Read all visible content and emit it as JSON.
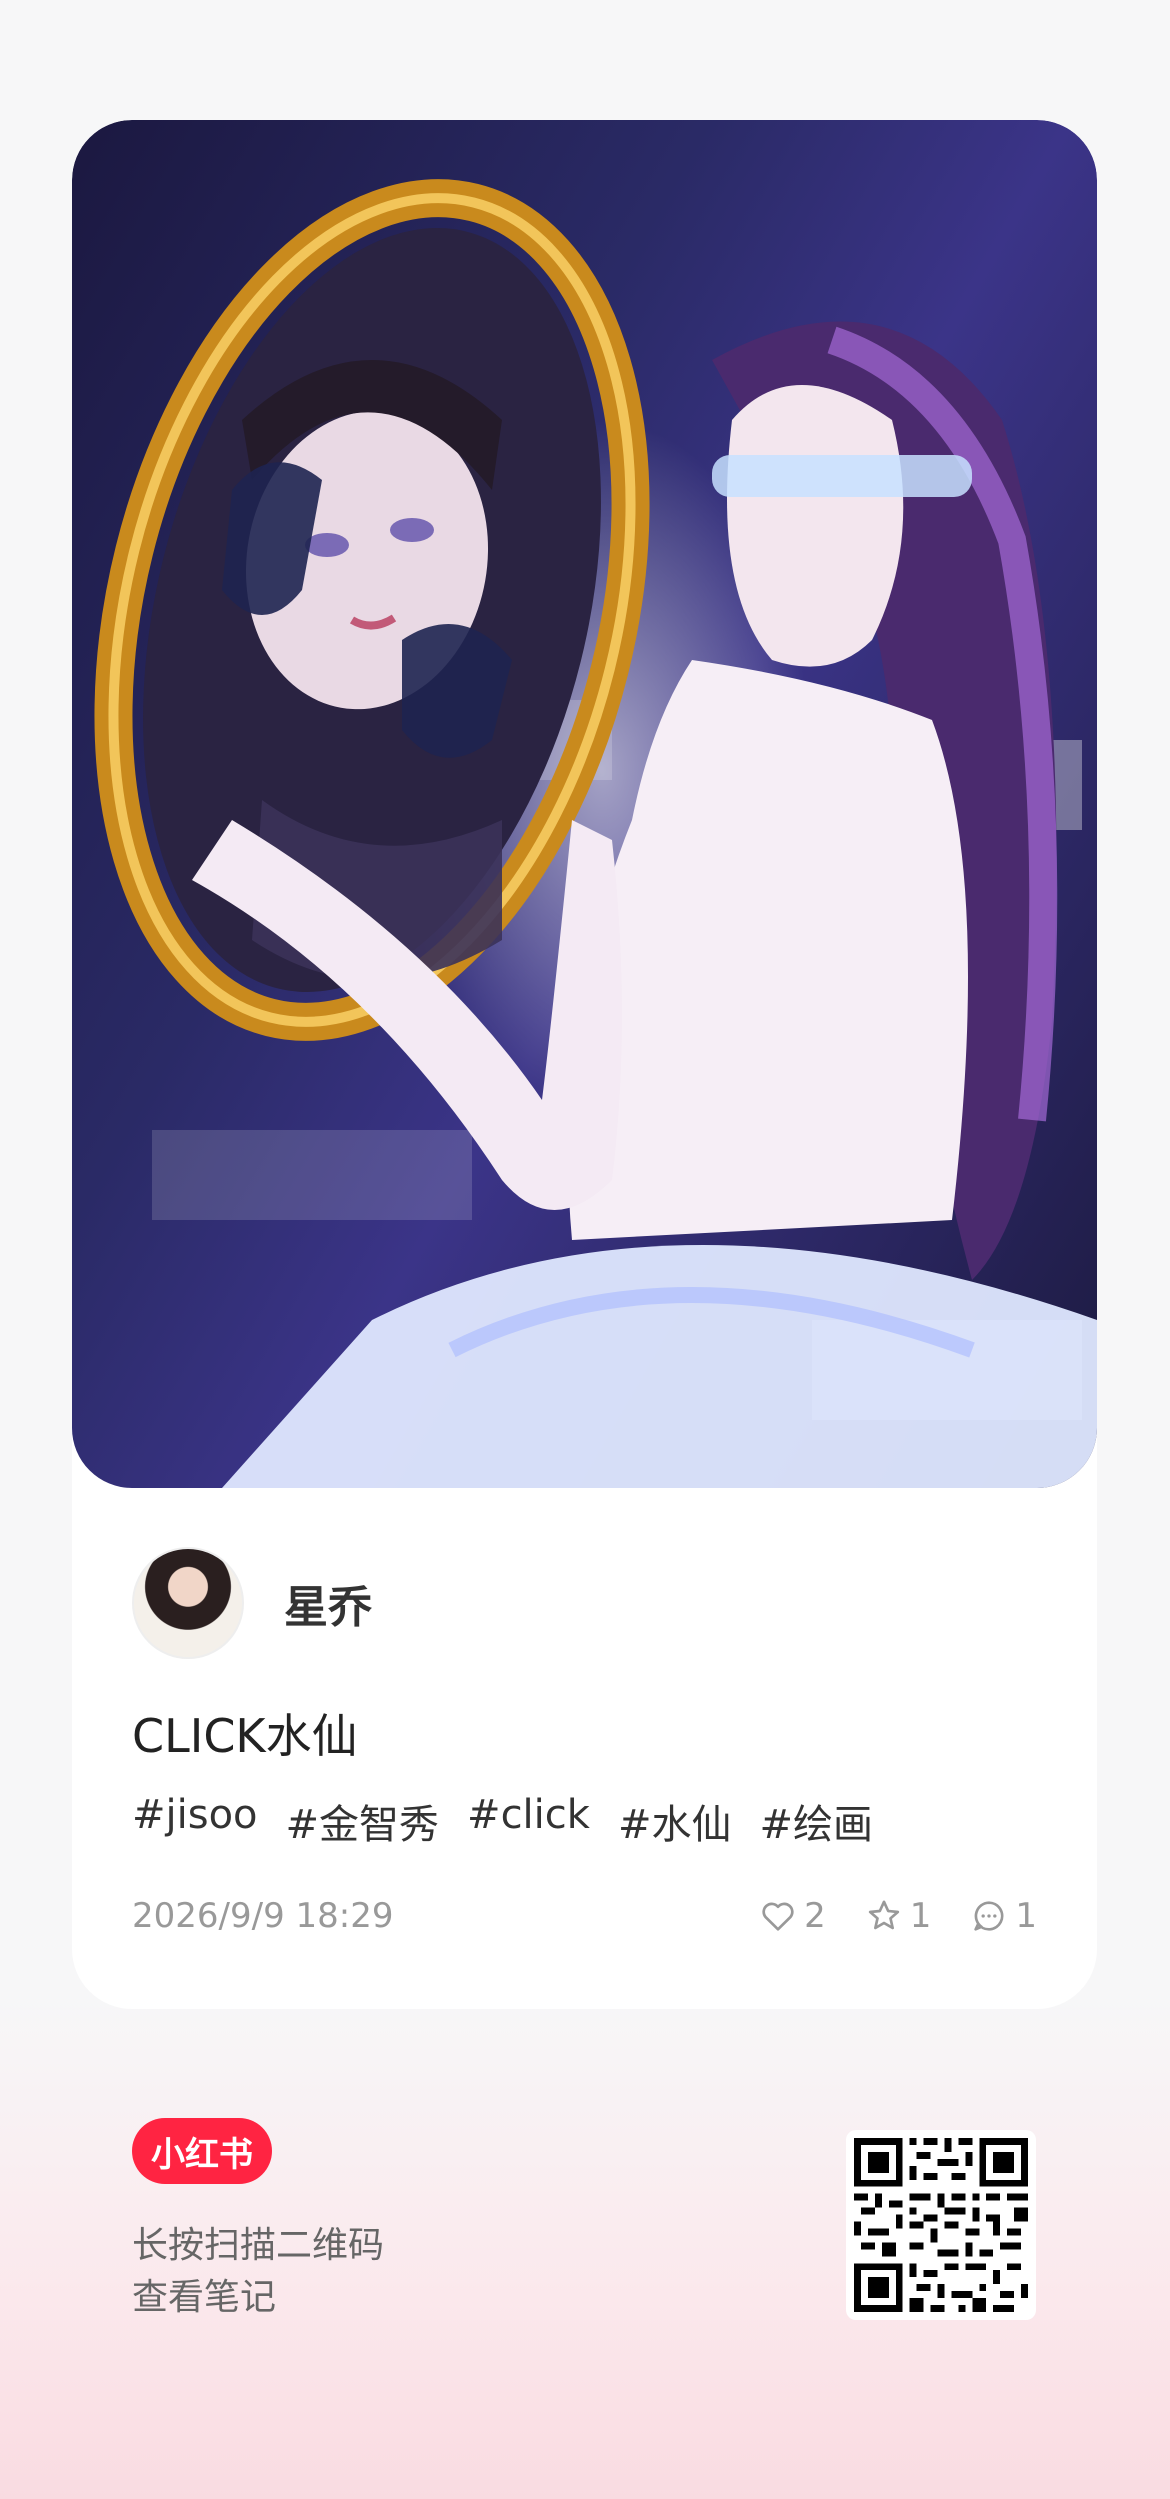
{
  "post": {
    "username": "星乔",
    "title": "CLICK水仙",
    "tags": [
      "#jisoo",
      "#金智秀",
      "#click",
      "#水仙",
      "#绘画"
    ],
    "timestamp": "2026/9/9 18:29",
    "likes": "2",
    "collects": "1",
    "comments": "1"
  },
  "footer": {
    "brand": "小红书",
    "hint_line1": "长按扫描二维码",
    "hint_line2": "查看笔记"
  },
  "colors": {
    "brand": "#ff2442",
    "background": "#f7f7f8",
    "bottom_gradient": "#f9dbe1"
  },
  "icons": [
    "heart-icon",
    "star-icon",
    "comment-icon"
  ]
}
